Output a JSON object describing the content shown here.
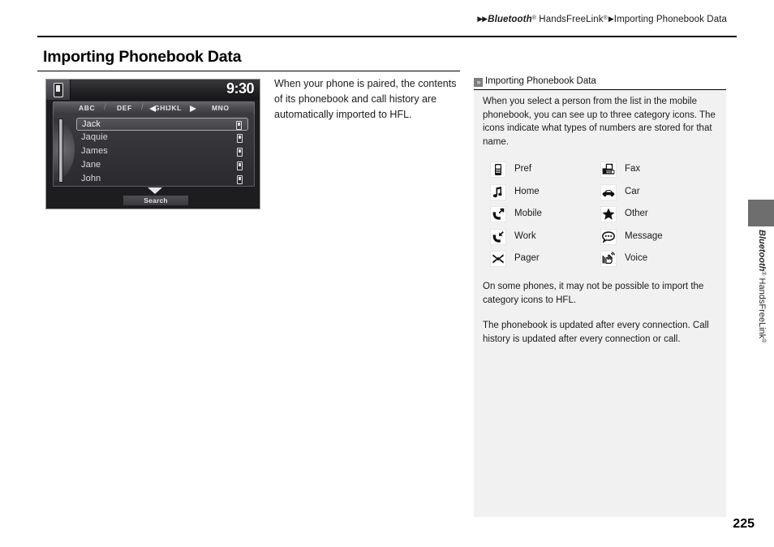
{
  "breadcrumb": {
    "arrow": "▶▶",
    "sep_arrow": "▶",
    "part1": "Bluetooth",
    "sup1": "®",
    "part2": " HandsFreeLink",
    "sup2": "®",
    "part3": "Importing Phonebook Data"
  },
  "page_title": "Importing Phonebook Data",
  "device": {
    "clock": "9:30",
    "phone_icon": "phone-icon",
    "alpha_tabs": [
      "ABC",
      "DEF",
      "GHI",
      "JKL",
      "MNO"
    ],
    "prev_arrow": "◀",
    "next_arrow": "▶",
    "contacts": [
      {
        "name": "Jack",
        "icon": "phone-icon",
        "selected": true
      },
      {
        "name": "Jaquie",
        "icon": "phone-icon",
        "selected": false
      },
      {
        "name": "James",
        "icon": "phone-icon",
        "selected": false
      },
      {
        "name": "Jane",
        "icon": "phone-icon",
        "selected": false
      },
      {
        "name": "John",
        "icon": "phone-icon",
        "selected": false
      }
    ],
    "scroll_down_icon": "chevron-down-icon",
    "search_label": "Search"
  },
  "body_copy": "When your phone is paired, the contents of its phonebook and call history are automatically imported to HFL.",
  "panel": {
    "header_icon": "»",
    "header_title": "Importing Phonebook Data",
    "paragraph_1": "When you select a person from the list in the mobile phonebook, you can see up to three category icons. The icons indicate what types of numbers are stored for that name.",
    "paragraph_2": "On some phones, it may not be possible to import the category icons to HFL.",
    "paragraph_3": "The phonebook is updated after every connection. Call history is updated after every connection or call.",
    "icons_left": [
      {
        "label": "Pref",
        "icon": "phone-icon"
      },
      {
        "label": "Home",
        "icon": "music-note-icon"
      },
      {
        "label": "Mobile",
        "icon": "mobile-handset-icon"
      },
      {
        "label": "Work",
        "icon": "work-handset-icon"
      },
      {
        "label": "Pager",
        "icon": "pager-icon"
      }
    ],
    "icons_right": [
      {
        "label": "Fax",
        "icon": "fax-icon"
      },
      {
        "label": "Car",
        "icon": "car-icon"
      },
      {
        "label": "Other",
        "icon": "star-icon"
      },
      {
        "label": "Message",
        "icon": "message-bubble-icon"
      },
      {
        "label": "Voice",
        "icon": "voice-hand-icon"
      }
    ]
  },
  "edge_tab": {
    "part1": "Bluetooth",
    "sup1": "®",
    "part2": " HandsFreeLink",
    "sup2": "®"
  },
  "page_number": "225",
  "colors": {
    "panel_bg": "#f1f1f1",
    "edge_tab": "#6e6e6e",
    "rule": "#000000",
    "text": "#1a1a1a"
  }
}
